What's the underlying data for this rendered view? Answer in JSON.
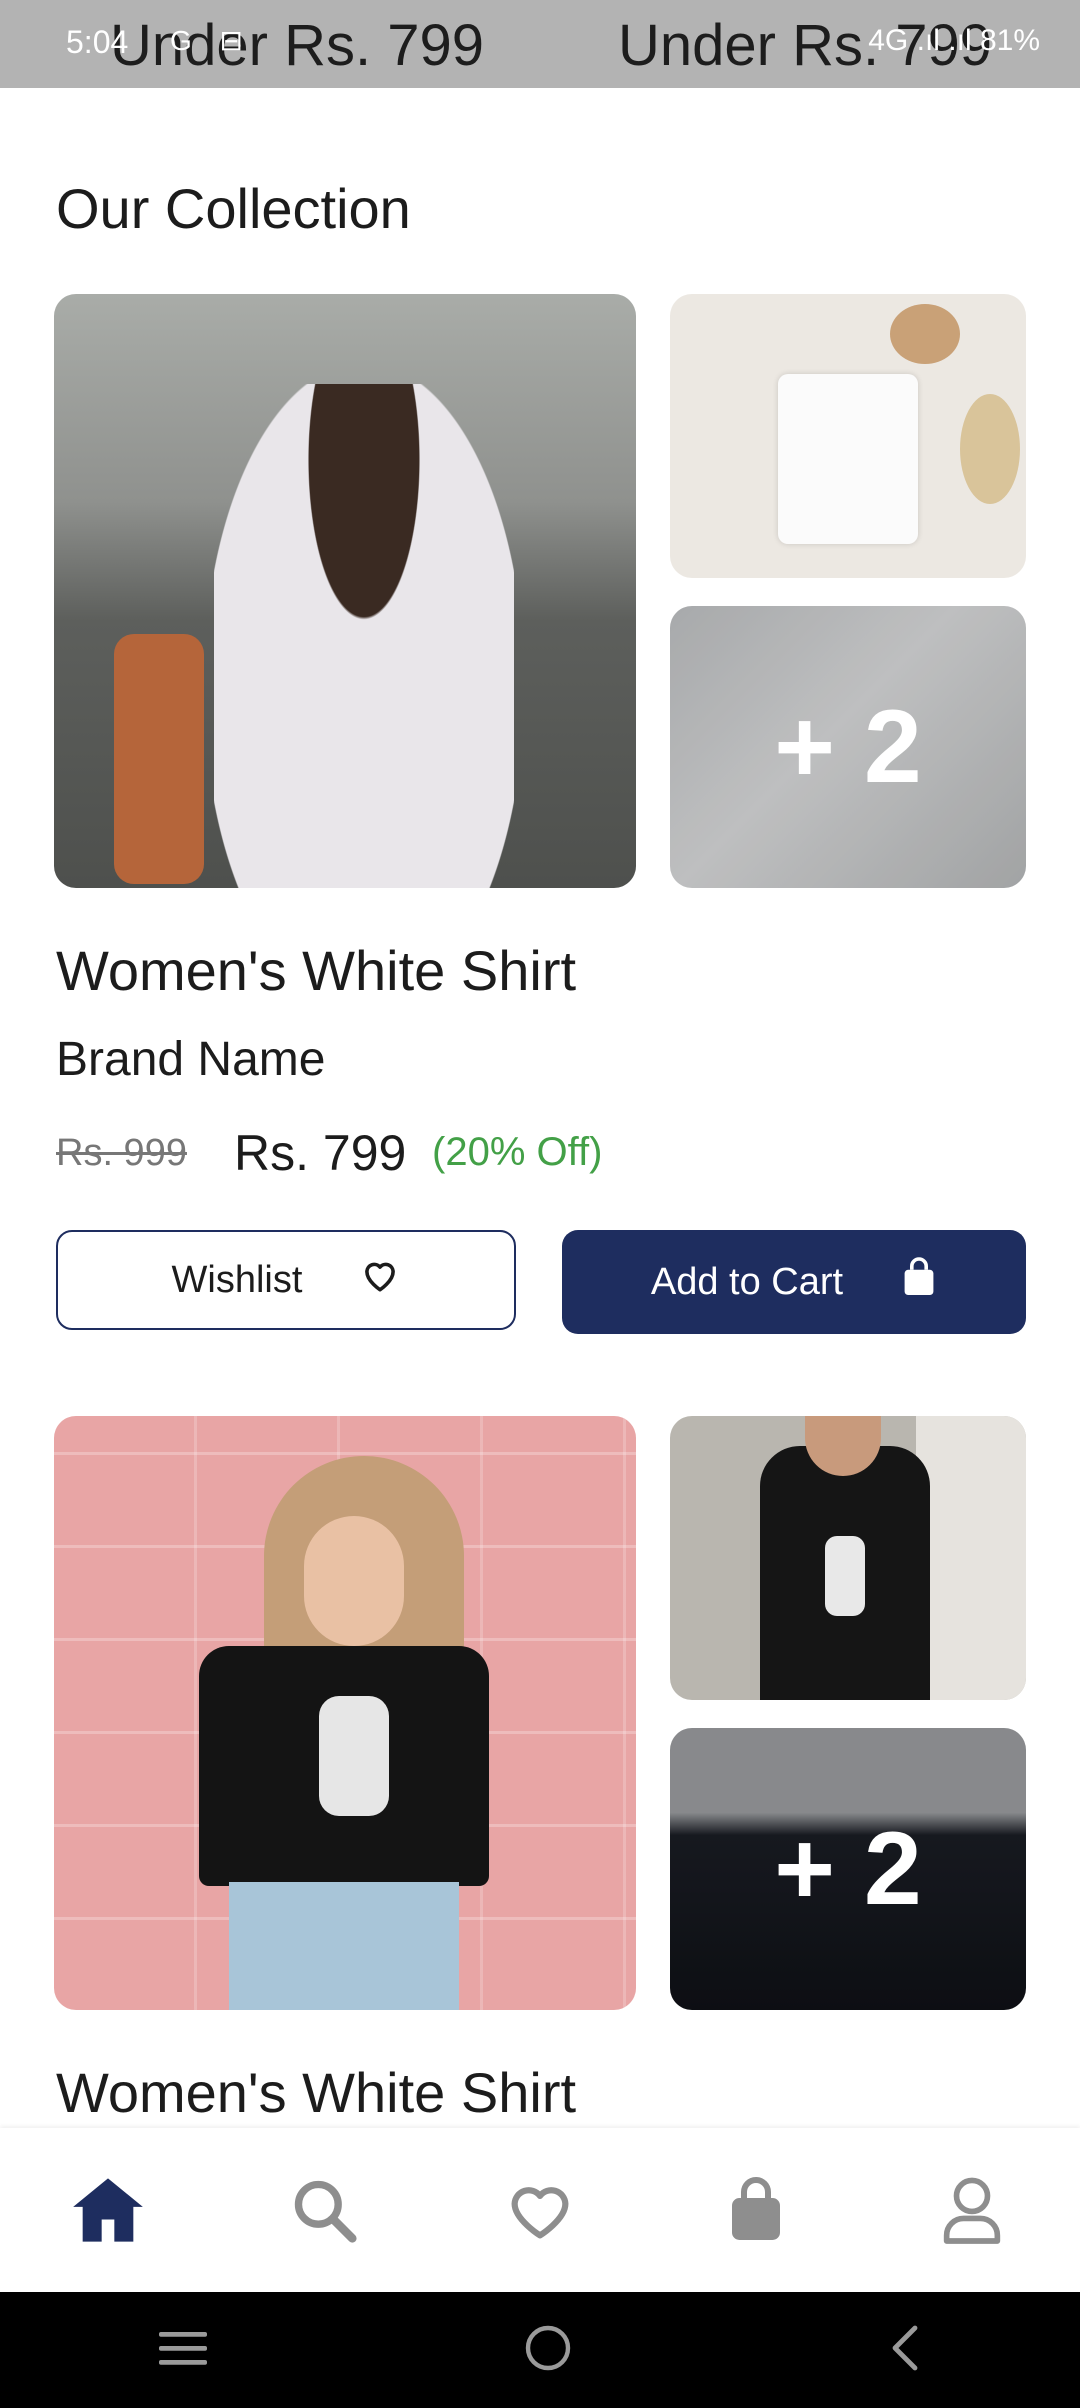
{
  "status_bar": {
    "time": "5:04",
    "left_icons": "G ⊟",
    "right_text": "4G .ıl .ıl 81%"
  },
  "banner_ghost": {
    "left_label": "Under Rs. 799",
    "right_label": "Under Rs. 799"
  },
  "section": {
    "title": "Our Collection"
  },
  "products": [
    {
      "title": "Women's White Shirt",
      "brand": "Brand Name",
      "old_price": "Rs. 999",
      "price": "Rs. 799",
      "discount": "(20% Off)",
      "more_images": "+ 2",
      "wishlist_label": "Wishlist",
      "cart_label": "Add to Cart"
    },
    {
      "title": "Women's White Shirt",
      "more_images": "+ 2"
    }
  ],
  "bottom_nav": [
    "home-icon",
    "search-icon",
    "heart-icon",
    "bag-icon",
    "profile-icon"
  ],
  "system_nav": [
    "menu-icon",
    "home-circle-icon",
    "back-icon"
  ],
  "colors": {
    "accent": "#1e2d5f",
    "discount": "#43a047"
  }
}
